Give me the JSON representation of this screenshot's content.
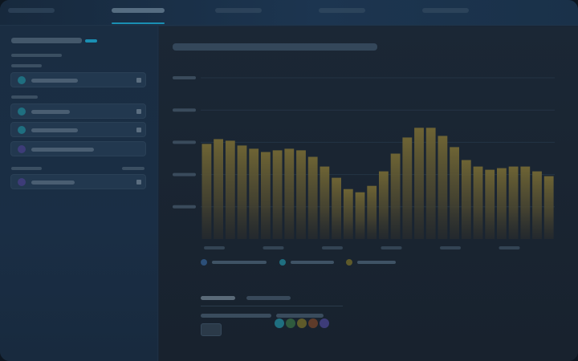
{
  "colors": {
    "accent": "#1a8fb3",
    "bar_fill": "#6b6233",
    "teal": "#1f6f80",
    "blue": "#2c4f78",
    "olive": "#5e5a2a",
    "purple": "#3d3c78",
    "green": "#2f5a3e",
    "brown": "#5e3b2a"
  },
  "topnav": {
    "tabs": [
      {
        "icon": "tab-placeholder"
      },
      {
        "icon": "tab-placeholder",
        "active": true
      },
      {
        "icon": "tab-placeholder"
      },
      {
        "icon": "tab-placeholder"
      },
      {
        "icon": "tab-placeholder"
      }
    ]
  },
  "sidebar": {
    "items": [
      {
        "dot_color": "#1f6f80",
        "icon": "status-dot-icon"
      },
      {
        "dot_color": "#1f6f80",
        "icon": "status-dot-icon"
      },
      {
        "dot_color": "#1f6f80",
        "icon": "status-dot-icon"
      },
      {
        "dot_color": "#3d3c78",
        "icon": "status-dot-icon"
      },
      {
        "dot_color": "#3d3c78",
        "icon": "status-dot-icon"
      }
    ]
  },
  "chart_data": {
    "type": "bar",
    "values": [
      0.59,
      0.62,
      0.61,
      0.58,
      0.56,
      0.54,
      0.55,
      0.56,
      0.55,
      0.51,
      0.45,
      0.38,
      0.31,
      0.29,
      0.33,
      0.42,
      0.53,
      0.63,
      0.69,
      0.69,
      0.64,
      0.57,
      0.49,
      0.45,
      0.43,
      0.44,
      0.45,
      0.45,
      0.42,
      0.39
    ],
    "ylim": [
      0,
      1
    ],
    "grid": true,
    "legend_placement": "bottom-left",
    "series_colors": [
      "#2c4f78",
      "#1f6f80",
      "#5e5a2a"
    ]
  },
  "bottom_panel": {
    "swatches": [
      "#1f6f80",
      "#2f5a3e",
      "#5e5a2a",
      "#5e3b2a",
      "#3d3c78"
    ]
  }
}
